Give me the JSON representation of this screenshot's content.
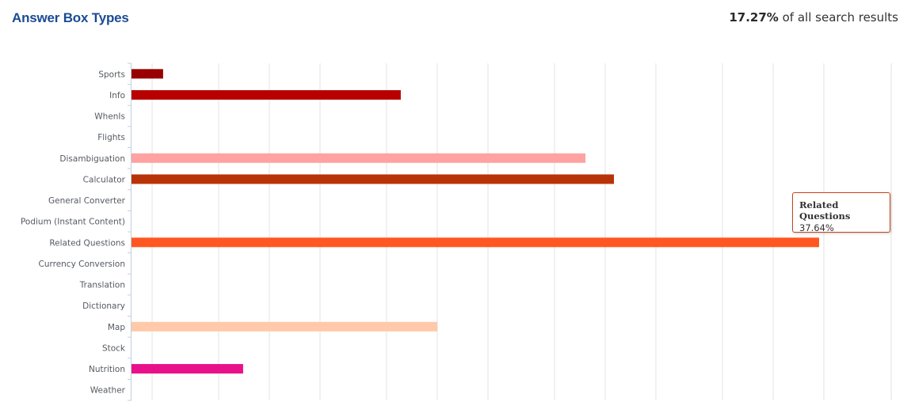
{
  "header": {
    "title": "Answer Box Types",
    "summary_value": "17.27%",
    "summary_text": "of all search results"
  },
  "tooltip": {
    "name": "Related Questions",
    "value": "37.64%"
  },
  "chart_data": {
    "type": "bar",
    "orientation": "horizontal",
    "title": "Answer Box Types",
    "xlabel": "",
    "ylabel": "",
    "grid": true,
    "unit": "%",
    "xlim": [
      0,
      41.5
    ],
    "categories": [
      "Sports",
      "Info",
      "WhenIs",
      "Flights",
      "Disambiguation",
      "Calculator",
      "General Converter",
      "Podium (Instant Content)",
      "Related Questions",
      "Currency Conversion",
      "Translation",
      "Dictionary",
      "Map",
      "Stock",
      "Nutrition",
      "Weather"
    ],
    "values": [
      1.73,
      14.74,
      0,
      0,
      24.85,
      26.41,
      0,
      0,
      37.64,
      0,
      0,
      0,
      16.74,
      0,
      6.11,
      0
    ],
    "colors": [
      "#990000",
      "#b80000",
      "#cccccc",
      "#cccccc",
      "#ffa2a2",
      "#b83308",
      "#cccccc",
      "#cccccc",
      "#ff5722",
      "#cccccc",
      "#cccccc",
      "#cccccc",
      "#ffc9aa",
      "#cccccc",
      "#e8118a",
      "#cccccc"
    ]
  }
}
